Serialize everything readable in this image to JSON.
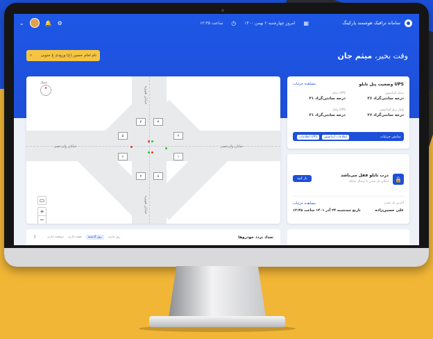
{
  "topbar": {
    "app_title": "سامانه ترافیک هوشمند پارکینگ",
    "date_text": "امروز چهارشنبه ۲ بهمن ۱۴۰۰",
    "time_text": "ساعت ۱۲:۴۵"
  },
  "header": {
    "greeting_prefix": "وقت بخیر،",
    "greeting_name": "میثم جان",
    "search_placeholder": "نام امام حسین (ع) ورودی غ جنوبی"
  },
  "map": {
    "compass_label": "شمال",
    "street_left": "خیابان ولی‌عصر",
    "street_right": "خیابان ولی‌عصر",
    "street_top": "خیابان هویزه",
    "street_bottom": "خیابان هویزه",
    "lanes": [
      "۱",
      "۲",
      "۳",
      "۴",
      "۵",
      "۶",
      "۷",
      "۸"
    ],
    "zoom_in": "+",
    "zoom_out": "−"
  },
  "ups": {
    "title": "وضعیت پنل تابلو UPS",
    "details_link": "مشاهده جزئیات",
    "stats": [
      {
        "label": "دمای آسانسور",
        "value": "۲۶ درجه سانتی‌گراد"
      },
      {
        "label": "دمای UPS",
        "value": "۳۱ درجه سانتی‌گراد"
      },
      {
        "label": "ولتاژ برق آسانسور",
        "value": "۲۶ درجه سانتی‌گراد"
      },
      {
        "label": "ولتاژ UPS",
        "value": "۳۱ درجه سانتی‌گراد"
      }
    ],
    "tab_main": "نمایش جزئیات",
    "tab_chip_1": "اطلاعات آسانسور",
    "tab_chip_2": "اطلاعات UPS"
  },
  "door": {
    "title": "درب تابلو قفل می‌باشد",
    "subtitle": "امکان باز شدن با ارسال پیامک",
    "open_button": "باز کنید",
    "details_link": "مشاهده جزئیات",
    "last_open_label": "آخرین باز شدن",
    "last_open_user": "علی حسین‌زاده",
    "last_open_time": "تاریخ سه‌شنبه ۲۴ آذر ۱۴۰۱ ساعت ۱۲:۴۵"
  },
  "traffic": {
    "title": "تعداد تردد خودروها",
    "tabs": [
      "روز جاری",
      "روز گذشته",
      "هفته جاری",
      "دوهفته جاری"
    ],
    "active_tab": "روز گذشته"
  }
}
